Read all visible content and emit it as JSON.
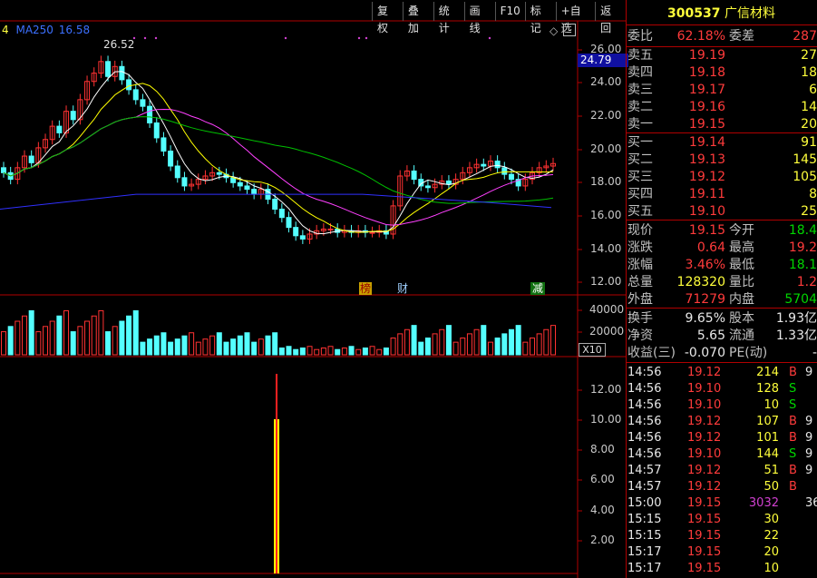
{
  "toolbar": [
    "复权",
    "叠加",
    "统计",
    "画线",
    "F10",
    "标记",
    "+自选",
    "返回"
  ],
  "ma_legend": {
    "prefix": "4",
    "label": "MA250",
    "value": "16.58"
  },
  "peak_label": "26.52",
  "price_axis": [
    "26.00",
    "24.00",
    "22.00",
    "20.00",
    "18.00",
    "16.00",
    "14.00",
    "12.00"
  ],
  "price_marker": "24.79",
  "vol_axis": [
    "40000",
    "20000"
  ],
  "vol_unit": "X10",
  "ind_axis": [
    "12.00",
    "10.00",
    "8.00",
    "6.00",
    "4.00",
    "2.00"
  ],
  "events": {
    "bang": "榜",
    "cai": "财",
    "jian": "减"
  },
  "colors": {
    "up": "#ff3232",
    "down": "#54ffff",
    "ma1": "#ffffff",
    "ma2": "#ffff00",
    "ma3": "#ff40ff",
    "ma4": "#00c000",
    "ma5": "#3030ff",
    "grid": "#b00000"
  },
  "quote": {
    "code": "300537",
    "name": "广信材料",
    "weibi_label": "委比",
    "weibi": "62.18%",
    "weicha_label": "委差",
    "weicha": "287",
    "asks": [
      {
        "label": "卖五",
        "price": "19.19",
        "vol": "27"
      },
      {
        "label": "卖四",
        "price": "19.18",
        "vol": "18"
      },
      {
        "label": "卖三",
        "price": "19.17",
        "vol": "6"
      },
      {
        "label": "卖二",
        "price": "19.16",
        "vol": "14"
      },
      {
        "label": "卖一",
        "price": "19.15",
        "vol": "20"
      }
    ],
    "bids": [
      {
        "label": "买一",
        "price": "19.14",
        "vol": "91"
      },
      {
        "label": "买二",
        "price": "19.13",
        "vol": "145"
      },
      {
        "label": "买三",
        "price": "19.12",
        "vol": "105"
      },
      {
        "label": "买四",
        "price": "19.11",
        "vol": "8"
      },
      {
        "label": "买五",
        "price": "19.10",
        "vol": "25"
      }
    ],
    "stats": [
      {
        "l1": "现价",
        "v1": "19.15",
        "l2": "今开",
        "v2": "18.4"
      },
      {
        "l1": "涨跌",
        "v1": "0.64",
        "l2": "最高",
        "v2": "19.2"
      },
      {
        "l1": "涨幅",
        "v1": "3.46%",
        "l2": "最低",
        "v2": "18.1"
      },
      {
        "l1": "总量",
        "v1": "128320",
        "l2": "量比",
        "v2": "1.2"
      },
      {
        "l1": "外盘",
        "v1": "71279",
        "l2": "内盘",
        "v2": "5704"
      }
    ],
    "stats2": [
      {
        "l1": "换手",
        "v1": "9.65%",
        "l2": "股本",
        "v2": "1.93亿"
      },
      {
        "l1": "净资",
        "v1": "5.65",
        "l2": "流通",
        "v2": "1.33亿"
      },
      {
        "l1": "收益(三)",
        "v1": "-0.070",
        "l2": "PE(动)",
        "v2": "-"
      }
    ]
  },
  "ticks": [
    {
      "time": "14:56",
      "price": "19.12",
      "vol": "214",
      "dir": "B",
      "extra": "9"
    },
    {
      "time": "14:56",
      "price": "19.10",
      "vol": "128",
      "dir": "S",
      "extra": ""
    },
    {
      "time": "14:56",
      "price": "19.10",
      "vol": "10",
      "dir": "S",
      "extra": ""
    },
    {
      "time": "14:56",
      "price": "19.12",
      "vol": "107",
      "dir": "B",
      "extra": "9"
    },
    {
      "time": "14:56",
      "price": "19.12",
      "vol": "101",
      "dir": "B",
      "extra": "9"
    },
    {
      "time": "14:56",
      "price": "19.10",
      "vol": "144",
      "dir": "S",
      "extra": "9"
    },
    {
      "time": "14:57",
      "price": "19.12",
      "vol": "51",
      "dir": "B",
      "extra": "9"
    },
    {
      "time": "14:57",
      "price": "19.12",
      "vol": "50",
      "dir": "B",
      "extra": ""
    },
    {
      "time": "15:00",
      "price": "19.15",
      "vol": "3032",
      "dir": "",
      "extra": "36"
    },
    {
      "time": "15:15",
      "price": "19.15",
      "vol": "30",
      "dir": "",
      "extra": ""
    },
    {
      "time": "15:15",
      "price": "19.15",
      "vol": "22",
      "dir": "",
      "extra": ""
    },
    {
      "time": "15:17",
      "price": "19.15",
      "vol": "20",
      "dir": "",
      "extra": ""
    },
    {
      "time": "15:17",
      "price": "19.15",
      "vol": "10",
      "dir": "",
      "extra": ""
    }
  ]
}
